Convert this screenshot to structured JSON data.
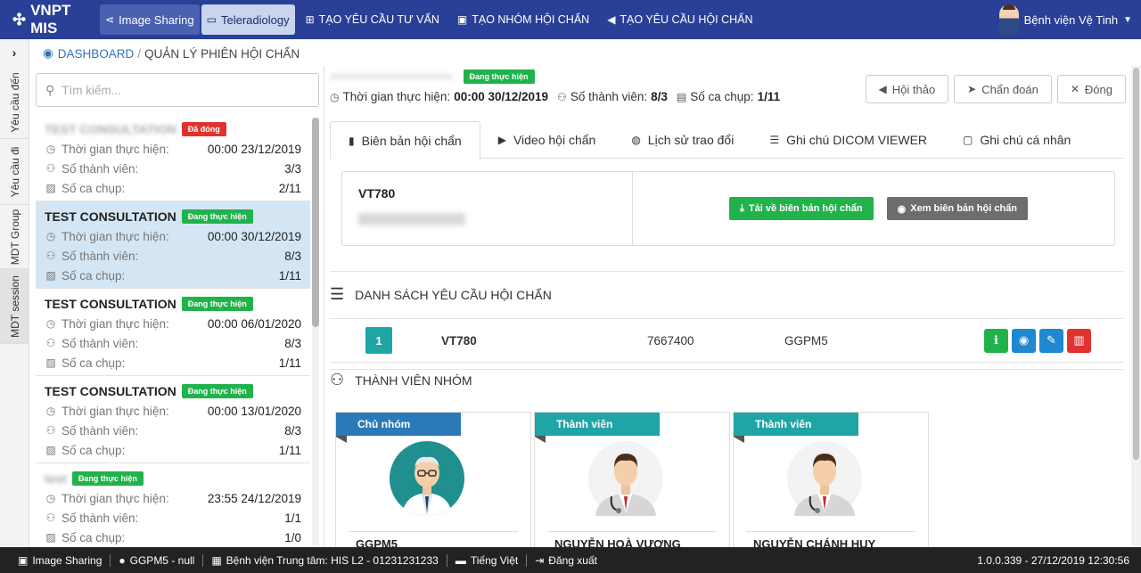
{
  "topbar": {
    "brand": "VNPT MIS",
    "modules": [
      {
        "label": "Image Sharing",
        "icon": "share-icon"
      },
      {
        "label": "Teleradiology",
        "icon": "monitor-icon"
      }
    ],
    "links": [
      {
        "label": "TẠO YÊU CẦU TƯ VẤN",
        "icon": "plus-square-icon"
      },
      {
        "label": "TẠO NHÓM HỘI CHẨN",
        "icon": "group-add-icon"
      },
      {
        "label": "TẠO YÊU CẦU HỘI CHẨN",
        "icon": "megaphone-icon"
      }
    ],
    "user": "Bệnh viện Vệ Tinh"
  },
  "vtabs": [
    "Yêu cầu đến",
    "Yêu cầu đi",
    "MDT Group",
    "MDT session"
  ],
  "breadcrumb": {
    "home": "DASHBOARD",
    "current": "QUẢN LÝ PHIÊN HỘI CHẨN"
  },
  "search": {
    "placeholder": "Tìm kiếm..."
  },
  "list": {
    "labels": {
      "time": "Thời gian thực hiện:",
      "members": "Số thành viên:",
      "shots": "Số ca chụp:"
    },
    "items": [
      {
        "name": "TEST CONSULTATION",
        "name_blurred": true,
        "status": "Đã đóng",
        "status_color": "#e0322f",
        "time": "00:00 23/12/2019",
        "members": "3/3",
        "shots": "2/11"
      },
      {
        "name": "TEST CONSULTATION",
        "name_blurred": false,
        "status": "Đang thực hiện",
        "status_color": "#21b24b",
        "time": "00:00 30/12/2019",
        "members": "8/3",
        "shots": "1/11"
      },
      {
        "name": "TEST CONSULTATION",
        "name_blurred": false,
        "status": "Đang thực hiện",
        "status_color": "#21b24b",
        "time": "00:00 06/01/2020",
        "members": "8/3",
        "shots": "1/11"
      },
      {
        "name": "TEST CONSULTATION",
        "name_blurred": false,
        "status": "Đang thực hiện",
        "status_color": "#21b24b",
        "time": "00:00 13/01/2020",
        "members": "8/3",
        "shots": "1/11"
      },
      {
        "name": "test",
        "name_blurred": true,
        "status": "Đang thực hiện",
        "status_color": "#21b24b",
        "time": "23:55 24/12/2019",
        "members": "1/1",
        "shots": "1/0"
      }
    ]
  },
  "detail": {
    "status": "Đang thực hiện",
    "time_label": "Thời gian thực hiện:",
    "time_value": "00:00 30/12/2019",
    "members_label": "Số thành viên:",
    "members_value": "8/3",
    "shots_label": "Số ca chụp:",
    "shots_value": "1/11",
    "actions": [
      {
        "label": "Hội thảo",
        "icon": "megaphone-icon"
      },
      {
        "label": "Chẩn đoán",
        "icon": "paper-plane-icon"
      },
      {
        "label": "Đóng",
        "icon": "close-icon"
      }
    ],
    "tabs": [
      {
        "label": "Biên bản hội chẩn",
        "icon": "file-icon"
      },
      {
        "label": "Video hội chẩn",
        "icon": "play-icon"
      },
      {
        "label": "Lịch sử trao đổi",
        "icon": "chat-icon"
      },
      {
        "label": "Ghi chú DICOM VIEWER",
        "icon": "database-icon"
      },
      {
        "label": "Ghi chú cá nhân",
        "icon": "note-icon"
      }
    ],
    "report": {
      "code": "VT780",
      "download": "Tải về biên bản hội chẩn",
      "view": "Xem biên bản hội chẩn"
    },
    "requests": {
      "title": "DANH SÁCH YÊU CẦU HỘI CHẨN",
      "rows": [
        {
          "num": "1",
          "code": "VT780",
          "id": "7667400",
          "user": "GGPM5"
        }
      ]
    },
    "members": {
      "title": "THÀNH VIÊN NHÓM",
      "cards": [
        {
          "role": "Chủ nhóm",
          "role_color": "#2a79b9",
          "name": "GGPM5"
        },
        {
          "role": "Thành viên",
          "role_color": "#1fa5a6",
          "name": "NGUYỄN HOÀ VƯƠNG"
        },
        {
          "role": "Thành viên",
          "role_color": "#1fa5a6",
          "name": "NGUYỄN CHÁNH HUY"
        }
      ]
    }
  },
  "footer": {
    "app": "Image Sharing",
    "user": "GGPM5 - null",
    "hospital": "Bệnh viện Trung tâm: HIS L2 - 01231231233",
    "language": "Tiếng Việt",
    "logout": "Đăng xuất",
    "version": "1.0.0.339 - 27/12/2019 12:30:56"
  }
}
